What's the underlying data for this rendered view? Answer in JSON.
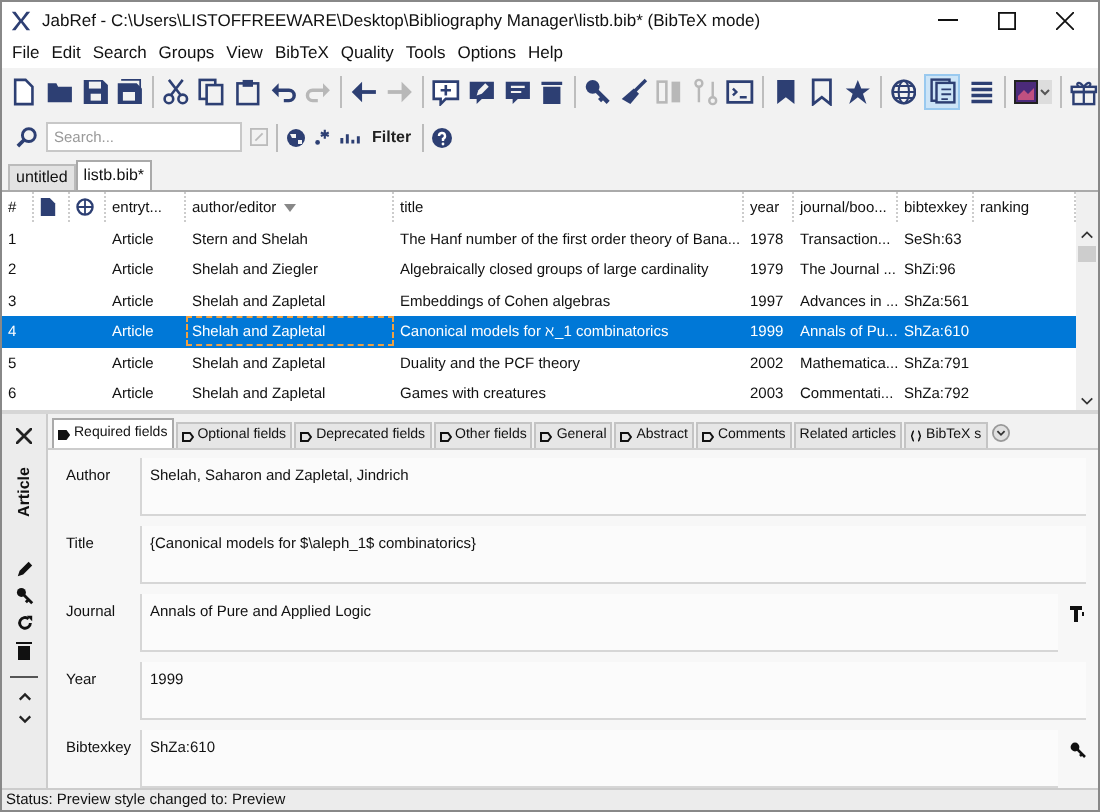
{
  "window": {
    "title": "JabRef - C:\\Users\\LISTOFFREEWARE\\Desktop\\Bibliography Manager\\listb.bib* (BibTeX mode)"
  },
  "menu": [
    "File",
    "Edit",
    "Search",
    "Groups",
    "View",
    "BibTeX",
    "Quality",
    "Tools",
    "Options",
    "Help"
  ],
  "toolbar": {
    "preview_toggle": {
      "selected": true
    }
  },
  "search": {
    "placeholder": "Search...",
    "filter_label": "Filter"
  },
  "library_tabs": [
    {
      "label": "untitled",
      "selected": false
    },
    {
      "label": "listb.bib*",
      "selected": true
    }
  ],
  "table": {
    "columns": [
      {
        "kind": "text",
        "label": "#",
        "sorted": false
      },
      {
        "kind": "file"
      },
      {
        "kind": "web"
      },
      {
        "kind": "text",
        "label": "entryt...",
        "sorted": false
      },
      {
        "kind": "text",
        "label": "author/editor",
        "sorted": true
      },
      {
        "kind": "text",
        "label": "title",
        "sorted": false
      },
      {
        "kind": "text",
        "label": "year",
        "sorted": false
      },
      {
        "kind": "text",
        "label": "journal/boo...",
        "sorted": false
      },
      {
        "kind": "text",
        "label": "bibtexkey",
        "sorted": false
      },
      {
        "kind": "text",
        "label": "ranking",
        "sorted": false
      }
    ],
    "rows": [
      {
        "number": "1",
        "type": "Article",
        "author": "Stern and Shelah",
        "title": "The Hanf number of the first order theory of Bana...",
        "year": "1978",
        "journal": "Transaction...",
        "key": "SeSh:63",
        "selected": false
      },
      {
        "number": "2",
        "type": "Article",
        "author": "Shelah and Ziegler",
        "title": "Algebraically closed groups of large cardinality",
        "year": "1979",
        "journal": "The Journal ...",
        "key": "ShZi:96",
        "selected": false
      },
      {
        "number": "3",
        "type": "Article",
        "author": "Shelah and Zapletal",
        "title": "Embeddings of Cohen algebras",
        "year": "1997",
        "journal": "Advances in ...",
        "key": "ShZa:561",
        "selected": false
      },
      {
        "number": "4",
        "type": "Article",
        "author": "Shelah and Zapletal",
        "title": "Canonical models for ℵ_1 combinatorics",
        "year": "1999",
        "journal": "Annals of Pu...",
        "key": "ShZa:610",
        "selected": true
      },
      {
        "number": "5",
        "type": "Article",
        "author": "Shelah and Zapletal",
        "title": "Duality and the PCF theory",
        "year": "2002",
        "journal": "Mathematica...",
        "key": "ShZa:791",
        "selected": false
      },
      {
        "number": "6",
        "type": "Article",
        "author": "Shelah and Zapletal",
        "title": "Games with creatures",
        "year": "2003",
        "journal": "Commentati...",
        "key": "ShZa:792",
        "selected": false
      }
    ]
  },
  "entry_editor": {
    "entry_type": "Article",
    "tabs": [
      {
        "label": "Required fields",
        "kind": "fields",
        "selected": true
      },
      {
        "label": "Optional fields",
        "kind": "fields",
        "selected": false
      },
      {
        "label": "Deprecated fields",
        "kind": "fields",
        "selected": false
      },
      {
        "label": "Other fields",
        "kind": "fields",
        "selected": false
      },
      {
        "label": "General",
        "kind": "fields",
        "selected": false
      },
      {
        "label": "Abstract",
        "kind": "fields",
        "selected": false
      },
      {
        "label": "Comments",
        "kind": "fields",
        "selected": false
      },
      {
        "label": "Related articles",
        "kind": "related",
        "selected": false
      },
      {
        "label": "BibTeX s",
        "kind": "source",
        "selected": false
      }
    ],
    "fields": [
      {
        "label": "Author",
        "value": "Shelah, Saharon and Zapletal, Jindrich",
        "kind": "text"
      },
      {
        "label": "Title",
        "value": "{Canonical models for $\\aleph_1$ combinatorics}",
        "kind": "text"
      },
      {
        "label": "Journal",
        "value": "Annals of Pure and Applied Logic",
        "kind": "journal"
      },
      {
        "label": "Year",
        "value": "1999",
        "kind": "text"
      },
      {
        "label": "Bibtexkey",
        "value": "ShZa:610",
        "kind": "key"
      }
    ]
  },
  "status_bar": "Status: Preview style changed to: Preview"
}
